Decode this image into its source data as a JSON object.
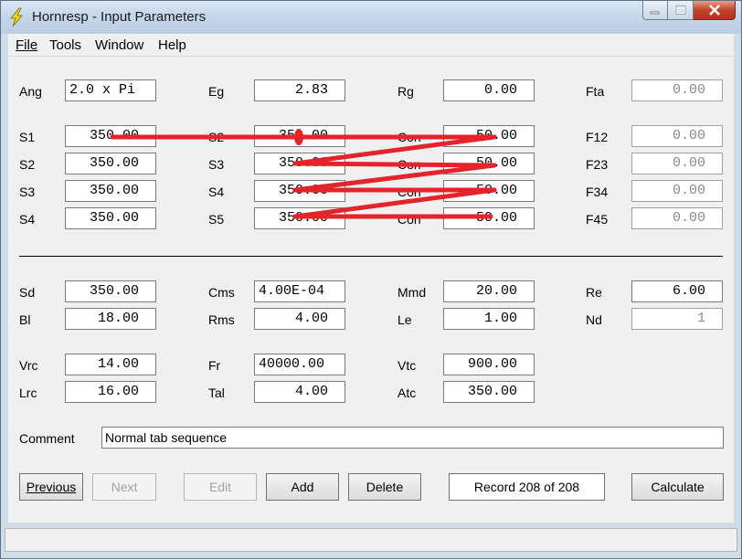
{
  "window": {
    "title": "Hornresp - Input Parameters"
  },
  "menu": {
    "file": "File",
    "tools": "Tools",
    "window": "Window",
    "help": "Help"
  },
  "params": {
    "ang": {
      "label": "Ang",
      "value": "2.0 x Pi"
    },
    "eg": {
      "label": "Eg",
      "value": "2.83"
    },
    "rg": {
      "label": "Rg",
      "value": "0.00"
    },
    "fta": {
      "label": "Fta",
      "value": "0.00"
    },
    "s1": {
      "label": "S1",
      "value": "350.00"
    },
    "s2a": {
      "label": "S2",
      "value": "350.00"
    },
    "s3a": {
      "label": "S3",
      "value": "350.00"
    },
    "s4a": {
      "label": "S4",
      "value": "350.00"
    },
    "s2b": {
      "label": "S2",
      "value": "350.00"
    },
    "s3b": {
      "label": "S3",
      "value": "350.00"
    },
    "s4b": {
      "label": "S4",
      "value": "350.00"
    },
    "s5": {
      "label": "S5",
      "value": "350.00"
    },
    "con1": {
      "label": "Con",
      "value": "50.00"
    },
    "con2": {
      "label": "Con",
      "value": "50.00"
    },
    "con3": {
      "label": "Con",
      "value": "50.00"
    },
    "con4": {
      "label": "Con",
      "value": "50.00"
    },
    "f12": {
      "label": "F12",
      "value": "0.00"
    },
    "f23": {
      "label": "F23",
      "value": "0.00"
    },
    "f34": {
      "label": "F34",
      "value": "0.00"
    },
    "f45": {
      "label": "F45",
      "value": "0.00"
    },
    "sd": {
      "label": "Sd",
      "value": "350.00"
    },
    "cms": {
      "label": "Cms",
      "value": "4.00E-04"
    },
    "mmd": {
      "label": "Mmd",
      "value": "20.00"
    },
    "re": {
      "label": "Re",
      "value": "6.00"
    },
    "bl": {
      "label": "Bl",
      "value": "18.00"
    },
    "rms": {
      "label": "Rms",
      "value": "4.00"
    },
    "le": {
      "label": "Le",
      "value": "1.00"
    },
    "nd": {
      "label": "Nd",
      "value": "1"
    },
    "vrc": {
      "label": "Vrc",
      "value": "14.00"
    },
    "fr": {
      "label": "Fr",
      "value": "40000.00"
    },
    "vtc": {
      "label": "Vtc",
      "value": "900.00"
    },
    "lrc": {
      "label": "Lrc",
      "value": "16.00"
    },
    "tal": {
      "label": "Tal",
      "value": "4.00"
    },
    "atc": {
      "label": "Atc",
      "value": "350.00"
    }
  },
  "comment": {
    "label": "Comment",
    "value": "Normal tab sequence"
  },
  "buttons": {
    "previous": "Previous",
    "next": "Next",
    "edit": "Edit",
    "add": "Add",
    "delete": "Delete",
    "calculate": "Calculate"
  },
  "record": "Record 208 of 208",
  "colors": {
    "annotation": "#e3242b",
    "title_bar": "#c5d7ea",
    "client_bg": "#f0f0f0"
  }
}
